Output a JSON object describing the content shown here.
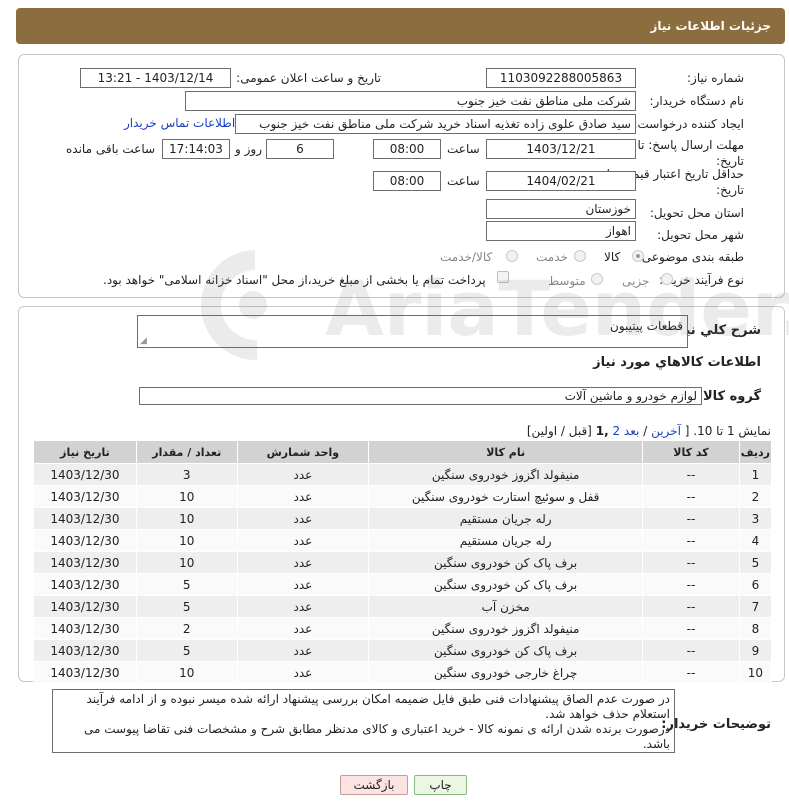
{
  "header": {
    "title": "جزئیات اطلاعات نیاز"
  },
  "form": {
    "need_number_label": "شماره نیاز:",
    "need_number": "1103092288005863",
    "announce_label": "تاریخ و ساعت اعلان عمومی:",
    "announce_value": "1403/12/14 - 13:21",
    "buyer_org_label": "نام دستگاه خریدار:",
    "buyer_org": "شرکت ملی مناطق نفت خیز جنوب",
    "creator_label": "ایجاد کننده درخواست:",
    "creator": "سید صادق علوی زاده  تغذیه اسناد خرید  شرکت ملی مناطق نفت خیز جنوب",
    "contact_link": "اطلاعات تماس خریدار",
    "deadline_label_1": "مهلت ارسال پاسخ: تا",
    "deadline_label_2": "تاریخ:",
    "deadline_date": "1403/12/21",
    "time_label": "ساعت",
    "deadline_time": "08:00",
    "days_value": "6",
    "days_label": "روز و",
    "remaining_time": "17:14:03",
    "remaining_label": "ساعت باقی مانده",
    "validity_label_1": "حداقل تاریخ اعتبار قیمت: تا",
    "validity_label_2": "تاریخ:",
    "validity_date": "1404/02/21",
    "validity_time": "08:00",
    "province_label": "استان محل تحویل:",
    "province": "خوزستان",
    "city_label": "شهر محل تحویل:",
    "city": "اهواز",
    "category_label": "طبقه بندی موضوعی:",
    "category_options": [
      "کالا",
      "خدمت",
      "کالا/خدمت"
    ],
    "category_selected": "کالا",
    "process_label": "نوع فرآیند خرید :",
    "process_options": [
      "جزیی",
      "متوسط"
    ],
    "payment_note": "پرداخت تمام یا بخشی از مبلغ خرید،از محل \"اسناد خزانه اسلامی\" خواهد بود."
  },
  "summary": {
    "label": "شرح کلي نياز:",
    "value": "قطعات پیتیبون"
  },
  "goods_info_title": "اطلاعات کالاهاي مورد نياز",
  "goods_group": {
    "label": "گروه کالا:",
    "value": "لوازم خودرو و ماشین آلات"
  },
  "pagination": {
    "prefix": "نمایش 1 تا 10. [",
    "last": "آخرین",
    "sep1": "/",
    "next": "بعد",
    "page2": "2",
    "current": ",1",
    "rest": "[قبل / اولین]"
  },
  "table": {
    "headers": [
      "ردیف",
      "کد کالا",
      "نام کالا",
      "واحد شمارش",
      "تعداد / مقدار",
      "تاریخ نیاز"
    ],
    "rows": [
      [
        "1",
        "--",
        "منیفولد اگزوز خودروی سنگین",
        "عدد",
        "3",
        "1403/12/30"
      ],
      [
        "2",
        "--",
        "قفل و سوئیچ استارت خودروی سنگین",
        "عدد",
        "10",
        "1403/12/30"
      ],
      [
        "3",
        "--",
        "رله جریان مستقیم",
        "عدد",
        "10",
        "1403/12/30"
      ],
      [
        "4",
        "--",
        "رله جریان مستقیم",
        "عدد",
        "10",
        "1403/12/30"
      ],
      [
        "5",
        "--",
        "برف پاک کن خودروی سنگین",
        "عدد",
        "10",
        "1403/12/30"
      ],
      [
        "6",
        "--",
        "برف پاک کن خودروی سنگین",
        "عدد",
        "5",
        "1403/12/30"
      ],
      [
        "7",
        "--",
        "مخزن آب",
        "عدد",
        "5",
        "1403/12/30"
      ],
      [
        "8",
        "--",
        "منیفولد اگزوز خودروی سنگین",
        "عدد",
        "2",
        "1403/12/30"
      ],
      [
        "9",
        "--",
        "برف پاک کن خودروی سنگین",
        "عدد",
        "5",
        "1403/12/30"
      ],
      [
        "10",
        "--",
        "چراغ خارجی خودروی سنگین",
        "عدد",
        "10",
        "1403/12/30"
      ]
    ]
  },
  "buyer_notes": {
    "label": "توضیحات خریدار:",
    "line1": "در صورت عدم الصاق پیشنهادات فنی طبق فایل ضمیمه امکان بررسی پیشنهاد ارائه شده میسر نبوده و از ادامه فرآیند",
    "line2": "استعلام حذف خواهد شد.",
    "line3": "درصورت برنده شدن ارائه ی نمونه کالا - خرید اعتباری و کالای مدنظر مطابق شرح و مشخصات فنی تقاضا پیوست می باشد."
  },
  "buttons": {
    "print": "چاپ",
    "back": "بازگشت"
  },
  "watermark": "AriaTender.neT"
}
